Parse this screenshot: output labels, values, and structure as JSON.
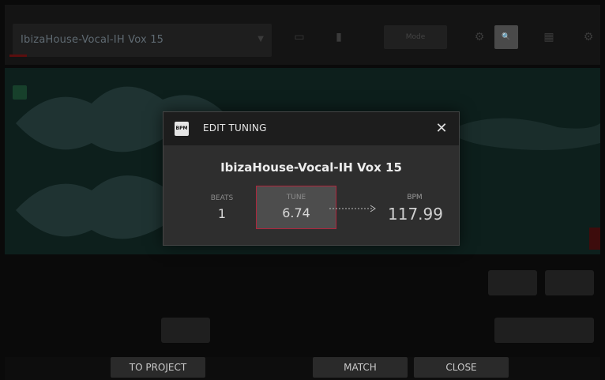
{
  "background": {
    "sample_name": "IbizaHouse-Vocal-IH Vox 15",
    "toolbar_mode_label": "Mode"
  },
  "dialog": {
    "badge": "BPM",
    "title": "EDIT TUNING",
    "close_glyph": "✕",
    "sample_name": "IbizaHouse-Vocal-IH Vox 15",
    "beats_label": "BEATS",
    "beats_value": "1",
    "tune_label": "TUNE",
    "tune_value": "6.74",
    "bpm_label": "BPM",
    "bpm_value": "117.99"
  },
  "bottom_bar": {
    "to_project": "TO PROJECT",
    "match": "MATCH",
    "close": "CLOSE"
  },
  "colors": {
    "accent_red": "#b0263d",
    "dialog_bg": "#2e2e2e",
    "header_bg": "#1d1d1d"
  },
  "icons": {
    "close": "close-icon",
    "bpm_badge": "bpm-badge-icon",
    "arrow": "dotted-arrow-icon"
  }
}
